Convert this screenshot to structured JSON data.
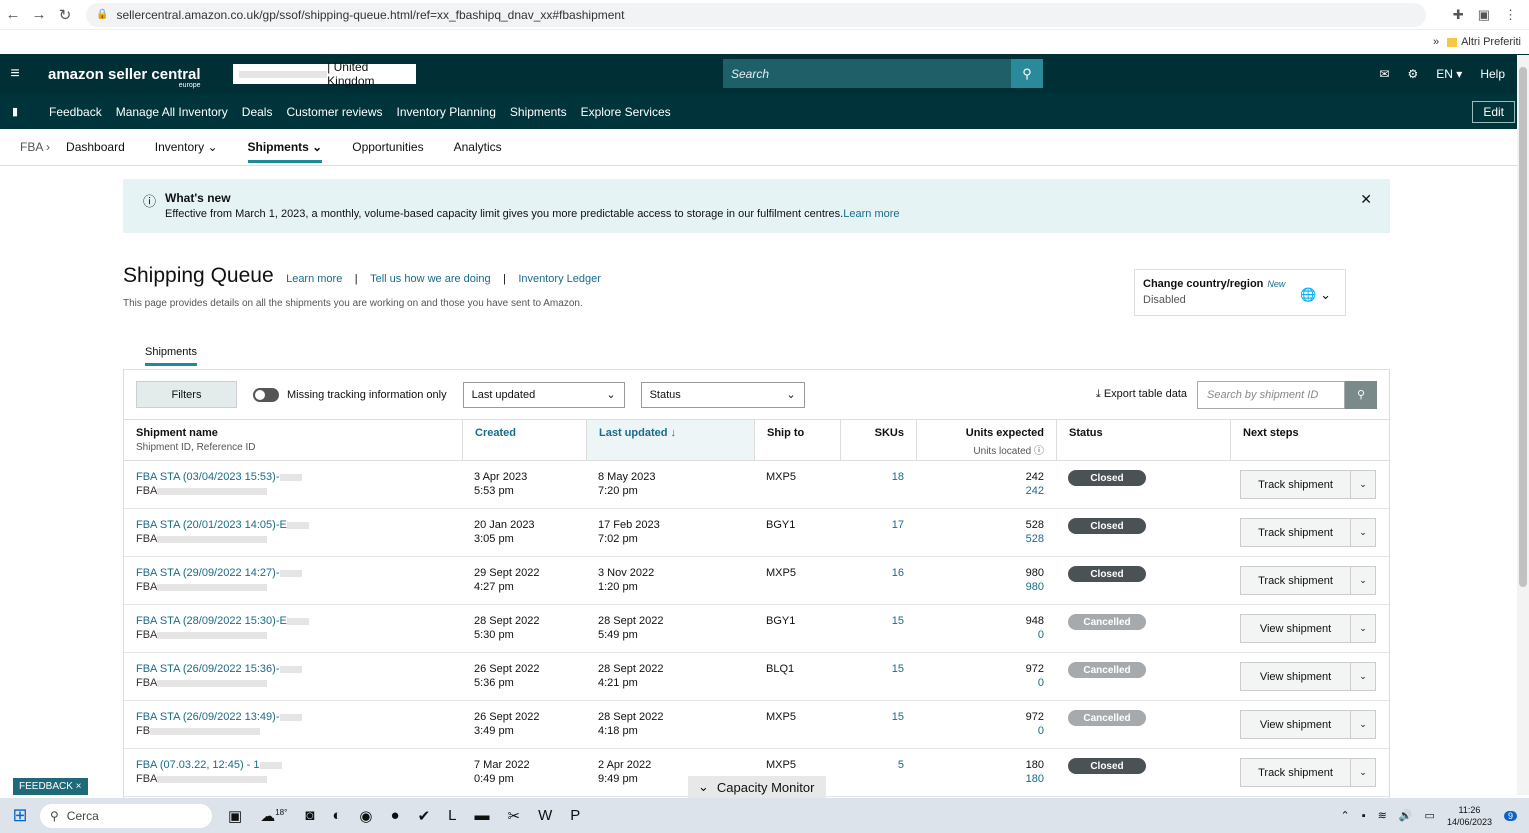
{
  "browser": {
    "url": "sellercentral.amazon.co.uk/gp/ssof/shipping-queue.html/ref=xx_fbashipq_dnav_xx#fbashipment",
    "bookmark_folder": "Altri Preferiti"
  },
  "topbar": {
    "logo": "amazon seller central",
    "logo_region": "europe",
    "marketplace": "| United Kingdom",
    "search_placeholder": "Search",
    "language": "EN",
    "help": "Help"
  },
  "navbar": {
    "links": [
      "Feedback",
      "Manage All Inventory",
      "Deals",
      "Customer reviews",
      "Inventory Planning",
      "Shipments",
      "Explore Services"
    ],
    "edit": "Edit"
  },
  "subnav": {
    "root": "FBA",
    "items": [
      "Dashboard",
      "Inventory",
      "Shipments",
      "Opportunities",
      "Analytics"
    ]
  },
  "banner": {
    "title": "What's new",
    "body": "Effective from March 1, 2023, a monthly, volume-based capacity limit gives you more predictable access to storage in our fulfilment centres.",
    "link": "Learn more"
  },
  "page": {
    "title": "Shipping Queue",
    "links": [
      "Learn more",
      "Tell us how we are doing",
      "Inventory Ledger"
    ],
    "description": "This page provides details on all the shipments you are working on and those you have sent to Amazon."
  },
  "country": {
    "title": "Change country/region",
    "badge": "New",
    "value": "Disabled"
  },
  "tab": "Shipments",
  "toolbar": {
    "filters": "Filters",
    "toggle_label": "Missing tracking information only",
    "sort_select": "Last updated",
    "status_select": "Status",
    "export": "Export table data",
    "search_placeholder": "Search by shipment ID"
  },
  "columns": {
    "name": "Shipment name",
    "name_sub": "Shipment ID, Reference ID",
    "created": "Created",
    "updated": "Last updated",
    "shipto": "Ship to",
    "skus": "SKUs",
    "units": "Units expected",
    "units_sub": "Units located",
    "status": "Status",
    "next": "Next steps"
  },
  "rows": [
    {
      "name": "FBA STA (03/04/2023 15:53)-",
      "id": "FBA",
      "created_date": "3 Apr 2023",
      "created_time": "5:53 pm",
      "updated_date": "8 May 2023",
      "updated_time": "7:20 pm",
      "shipto": "MXP5",
      "skus": "18",
      "units": "242",
      "located": "242",
      "status": "Closed",
      "action": "Track shipment"
    },
    {
      "name": "FBA STA (20/01/2023 14:05)-E",
      "id": "FBA",
      "created_date": "20 Jan 2023",
      "created_time": "3:05 pm",
      "updated_date": "17 Feb 2023",
      "updated_time": "7:02 pm",
      "shipto": "BGY1",
      "skus": "17",
      "units": "528",
      "located": "528",
      "status": "Closed",
      "action": "Track shipment"
    },
    {
      "name": "FBA STA (29/09/2022 14:27)-",
      "id": "FBA",
      "created_date": "29 Sept 2022",
      "created_time": "4:27 pm",
      "updated_date": "3 Nov 2022",
      "updated_time": "1:20 pm",
      "shipto": "MXP5",
      "skus": "16",
      "units": "980",
      "located": "980",
      "status": "Closed",
      "action": "Track shipment"
    },
    {
      "name": "FBA STA (28/09/2022 15:30)-E",
      "id": "FBA",
      "created_date": "28 Sept 2022",
      "created_time": "5:30 pm",
      "updated_date": "28 Sept 2022",
      "updated_time": "5:49 pm",
      "shipto": "BGY1",
      "skus": "15",
      "units": "948",
      "located": "0",
      "status": "Cancelled",
      "action": "View shipment"
    },
    {
      "name": "FBA STA (26/09/2022 15:36)-",
      "id": "FBA",
      "created_date": "26 Sept 2022",
      "created_time": "5:36 pm",
      "updated_date": "28 Sept 2022",
      "updated_time": "4:21 pm",
      "shipto": "BLQ1",
      "skus": "15",
      "units": "972",
      "located": "0",
      "status": "Cancelled",
      "action": "View shipment"
    },
    {
      "name": "FBA STA (26/09/2022 13:49)-",
      "id": "FB",
      "created_date": "26 Sept 2022",
      "created_time": "3:49 pm",
      "updated_date": "28 Sept 2022",
      "updated_time": "4:18 pm",
      "shipto": "MXP5",
      "skus": "15",
      "units": "972",
      "located": "0",
      "status": "Cancelled",
      "action": "View shipment"
    },
    {
      "name": "FBA (07.03.22, 12:45) - 1",
      "id": "FBA",
      "created_date": "7 Mar 2022",
      "created_time": "0:49 pm",
      "updated_date": "2 Apr 2022",
      "updated_time": "9:49 pm",
      "shipto": "MXP5",
      "skus": "5",
      "units": "180",
      "located": "180",
      "status": "Closed",
      "action": "Track shipment"
    }
  ],
  "feedback": "FEEDBACK ×",
  "capacity_monitor": "Capacity Monitor",
  "taskbar": {
    "search": "Cerca",
    "weather": "18°",
    "time": "11:26",
    "date": "14/06/2023",
    "notif": "9"
  }
}
